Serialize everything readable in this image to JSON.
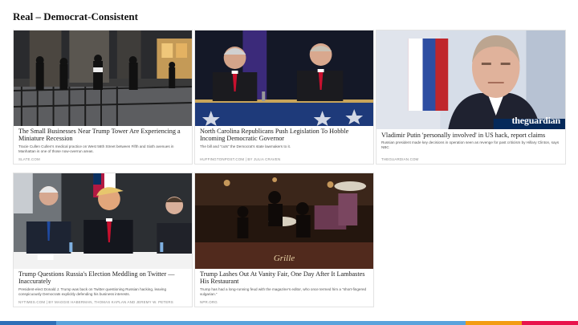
{
  "slide": {
    "title": "Real – Democrat-Consistent"
  },
  "cards": [
    {
      "headline": "The Small Businesses Near Trump Tower Are Experiencing a Miniature Recession",
      "snippet": "Tracie Cullen Cullen’s medical practice on West 56th Street between Fifth and Sixth avenues in Manhattan is one of those now-overrun areas.",
      "source": "SLATE.COM"
    },
    {
      "headline": "North Carolina Republicans Push Legislation To Hobble Incoming Democratic Governor",
      "snippet": "The bill and “cuts” the Democrat’s state lawmakers to it.",
      "source": "HUFFINGTONPOST.COM | BY JULIA CRAVEN"
    },
    {
      "headline": "Vladimir Putin 'personally involved' in US hack, report claims",
      "snippet": "Russian president made key decisions in operation seen as revenge for past criticism by Hillary Clinton, says NBC",
      "source": "THEGUARDIAN.COM",
      "logo": "theguardian"
    },
    {
      "headline": "Trump Questions Russia's Election Meddling on Twitter — Inaccurately",
      "snippet": "President-elect Donald J. Trump was back on Twitter questioning Russian hacking, leaving conspicuously Democrats explicitly defending his business interests.",
      "source": "NYTIMES.COM | BY MAGGIE HABERMAN, THOMAS KAPLAN AND JEREMY W. PETERS"
    },
    {
      "headline": "Trump Lashes Out At Vanity Fair, One Day After It Lambastes His Restaurant",
      "snippet": "Trump has had a long-running feud with the magazine’s editor, who once termed him a “short-fingered vulgarian.”",
      "source": "NPR.ORG",
      "sign": "Grille"
    }
  ],
  "footer": {
    "colors": [
      "#2d6fb7",
      "#5aa3dc",
      "#f39c12",
      "#e8144c"
    ]
  }
}
